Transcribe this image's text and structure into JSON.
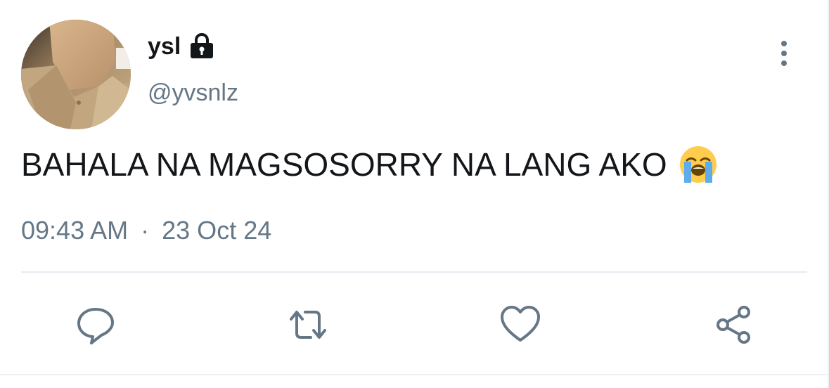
{
  "user": {
    "display_name": "ysl",
    "handle": "@yvsnlz",
    "avatar_icon": "profile-photo",
    "protected_icon": "lock-icon"
  },
  "tweet": {
    "text": "BAHALA NA MAGSOSORRY NA LANG AKO",
    "emoji": "loudly-crying-face",
    "time": "09:43 AM",
    "separator": "·",
    "date": "23 Oct 24"
  },
  "actions": [
    {
      "name": "reply",
      "icon": "comment-icon"
    },
    {
      "name": "retweet",
      "icon": "retweet-icon"
    },
    {
      "name": "like",
      "icon": "heart-icon"
    },
    {
      "name": "share",
      "icon": "share-icon"
    }
  ],
  "colors": {
    "text_primary": "#14171a",
    "text_secondary": "#657786",
    "icon_gray": "#657786",
    "divider": "#e6ecf0"
  }
}
